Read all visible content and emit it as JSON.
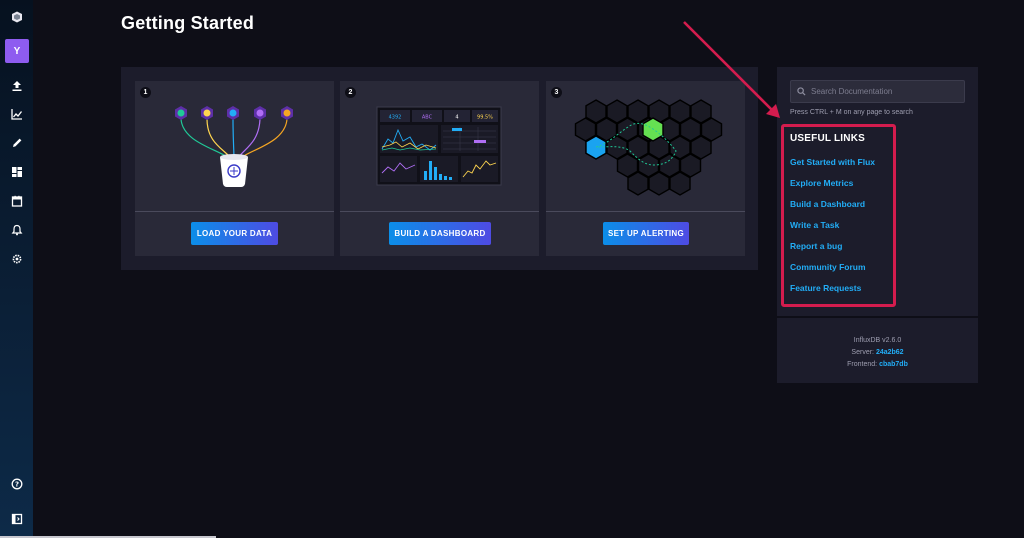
{
  "sidebar": {
    "org_initial": "Y",
    "items": [
      {
        "icon": "influx-logo-icon"
      },
      {
        "icon": "upload-icon"
      },
      {
        "icon": "graph-icon"
      },
      {
        "icon": "pencil-icon"
      },
      {
        "icon": "dashboards-icon"
      },
      {
        "icon": "tasks-icon"
      },
      {
        "icon": "bell-icon"
      },
      {
        "icon": "gear-icon"
      },
      {
        "icon": "help-icon"
      },
      {
        "icon": "collapse-icon"
      }
    ]
  },
  "page": {
    "title": "Getting Started"
  },
  "cards": [
    {
      "number": "1",
      "button_label": "LOAD YOUR DATA"
    },
    {
      "number": "2",
      "button_label": "BUILD A DASHBOARD",
      "dashboard_stats": [
        "4392",
        "ABC",
        "4",
        "99.5%"
      ]
    },
    {
      "number": "3",
      "button_label": "SET UP ALERTING"
    }
  ],
  "links_panel": {
    "search_placeholder": "Search Documentation",
    "search_hint": "Press CTRL + M on any page to search",
    "title": "USEFUL LINKS",
    "links": [
      "Get Started with Flux",
      "Explore Metrics",
      "Build a Dashboard",
      "Write a Task",
      "Report a bug",
      "Community Forum",
      "Feature Requests"
    ],
    "version": "InfluxDB v2.6.0",
    "server_label": "Server:",
    "server_value": "24a2b62",
    "frontend_label": "Frontend:",
    "frontend_value": "cbab7db"
  },
  "colors": {
    "accent_link": "#22adf6",
    "highlight": "#d41c4e",
    "button_gradient_start": "#0b8ee8",
    "button_gradient_end": "#4e4be3"
  }
}
